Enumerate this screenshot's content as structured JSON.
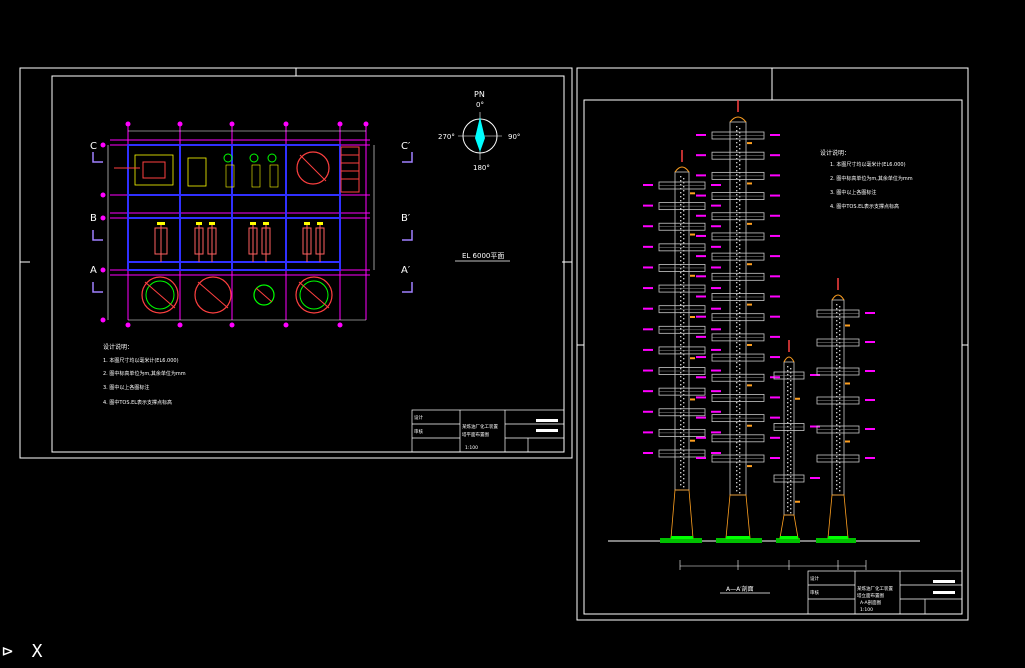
{
  "colors": {
    "background": "#000000",
    "frame": "#ffffff",
    "grid": "#ff00ff",
    "wall": "#0000ff",
    "dim": "#ffffff",
    "equip": "#ff4040",
    "green": "#00ff00",
    "tower": "#c8c8c8",
    "orange": "#ffa020",
    "text": "#ffffff",
    "cyan": "#00ffff"
  },
  "sheet1": {
    "north": {
      "pn": "PN",
      "deg0": "0°",
      "deg90": "90°",
      "deg180": "180°",
      "deg270": "270°"
    },
    "grid_rows": [
      "C",
      "B",
      "A"
    ],
    "grid_rows_prime": [
      "C′",
      "B′",
      "A′"
    ],
    "elevation_label": "EL 6000平面",
    "notes_title": "设计说明：",
    "notes": [
      "1. 本图尺寸均以毫米计(EL6.000)",
      "2. 图中标高单位为m,其余单位为mm",
      "3. 图中以上各图标注",
      "4. 图中TOS.EL表示支撑点标高"
    ],
    "title_block": {
      "row1": "设计",
      "row2": "审核",
      "proj": "某炼油厂化工装置",
      "drawing": "塔平面布置图",
      "scale": "1:100"
    }
  },
  "sheet2": {
    "notes_title": "设计说明：",
    "notes": [
      "1. 本图尺寸均以毫米计(EL6.000)",
      "2. 图中标高单位为m,其余单位为mm",
      "3. 图中以上各图标注",
      "4. 图中TOS.EL表示支撑点标高"
    ],
    "section_label": "A—A′剖面",
    "title_block": {
      "row1": "设计",
      "row2": "审核",
      "proj": "某炼油厂化工装置",
      "drawing": "塔立面布置图",
      "sub": "A-A剖面图",
      "scale": "1:100"
    }
  },
  "ucs_icon": "⊳ X"
}
